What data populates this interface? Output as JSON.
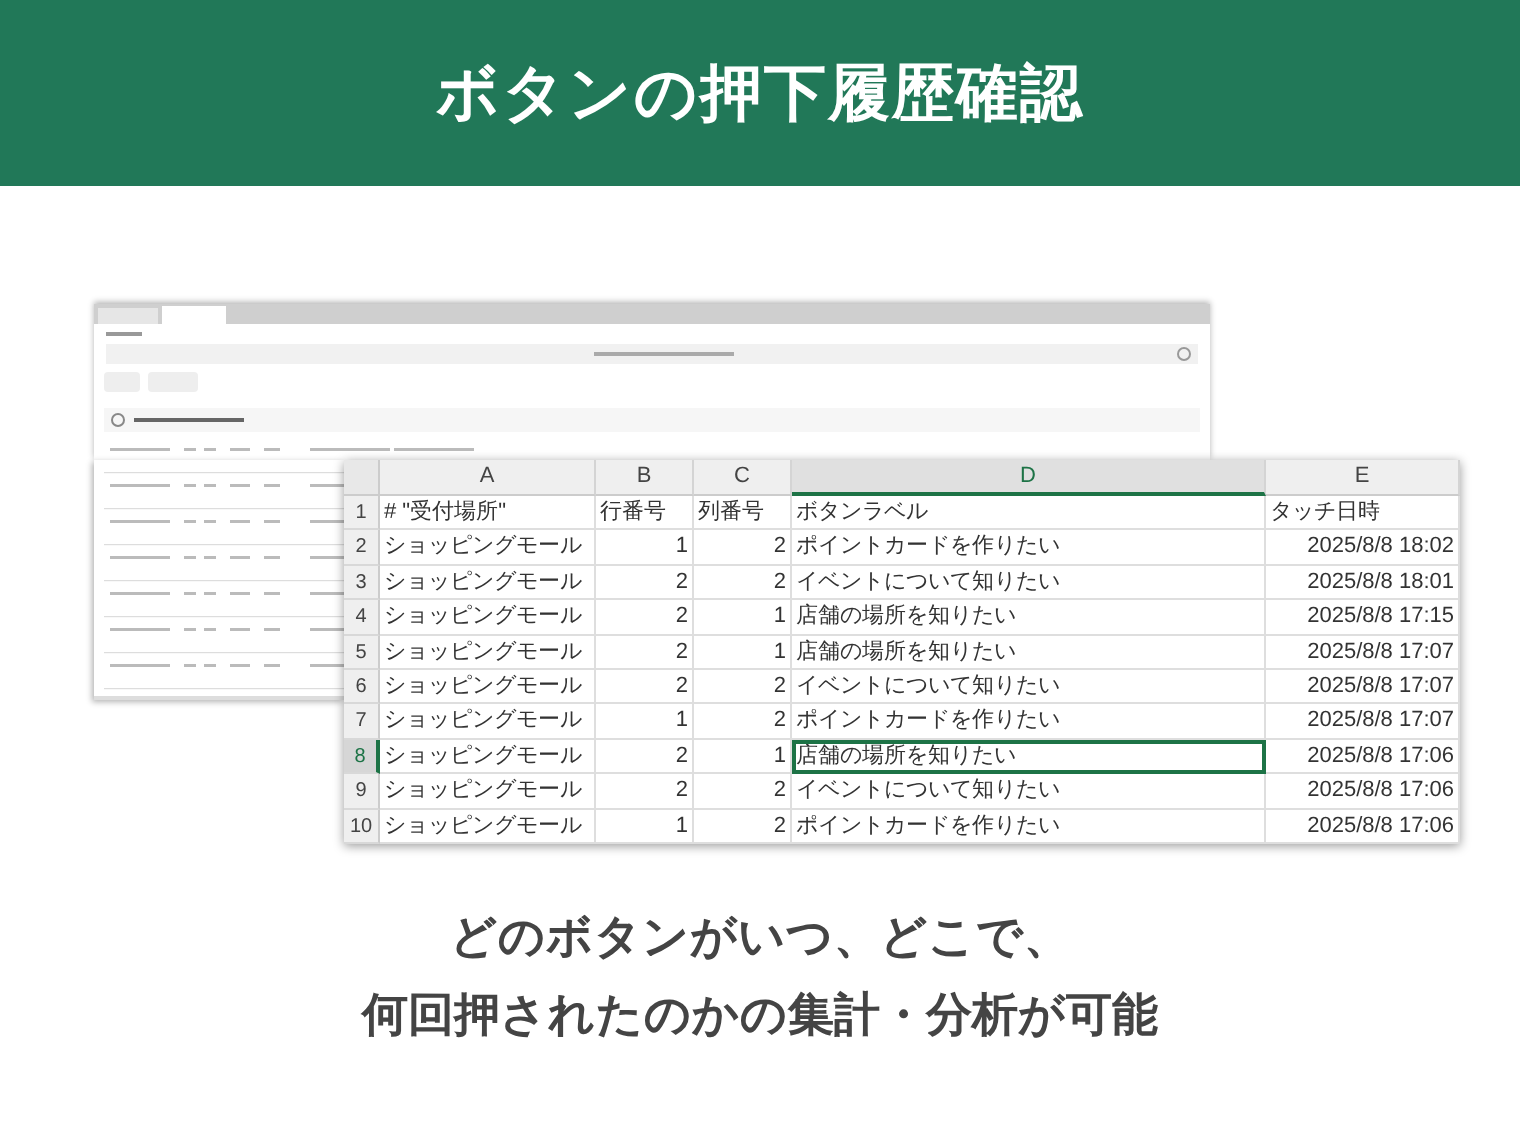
{
  "header": {
    "title": "ボタンの押下履歴確認"
  },
  "spreadsheet": {
    "columns": [
      {
        "label": "A",
        "kind": "text",
        "selected": false
      },
      {
        "label": "B",
        "kind": "number",
        "selected": false
      },
      {
        "label": "C",
        "kind": "number",
        "selected": false
      },
      {
        "label": "D",
        "kind": "text",
        "selected": true
      },
      {
        "label": "E",
        "kind": "number",
        "selected": false
      }
    ],
    "rows": [
      {
        "number": "1",
        "selected": false,
        "cells": [
          "# \"受付場所\"",
          "行番号",
          "列番号",
          "ボタンラベル",
          "タッチ日時"
        ]
      },
      {
        "number": "2",
        "selected": false,
        "cells": [
          "ショッピングモール",
          "1",
          "2",
          "ポイントカードを作りたい",
          "2025/8/8 18:02"
        ]
      },
      {
        "number": "3",
        "selected": false,
        "cells": [
          "ショッピングモール",
          "2",
          "2",
          "イベントについて知りたい",
          "2025/8/8 18:01"
        ]
      },
      {
        "number": "4",
        "selected": false,
        "cells": [
          "ショッピングモール",
          "2",
          "1",
          "店舗の場所を知りたい",
          "2025/8/8 17:15"
        ]
      },
      {
        "number": "5",
        "selected": false,
        "cells": [
          "ショッピングモール",
          "2",
          "1",
          "店舗の場所を知りたい",
          "2025/8/8 17:07"
        ]
      },
      {
        "number": "6",
        "selected": false,
        "cells": [
          "ショッピングモール",
          "2",
          "2",
          "イベントについて知りたい",
          "2025/8/8 17:07"
        ]
      },
      {
        "number": "7",
        "selected": false,
        "cells": [
          "ショッピングモール",
          "1",
          "2",
          "ポイントカードを作りたい",
          "2025/8/8 17:07"
        ]
      },
      {
        "number": "8",
        "selected": true,
        "cells": [
          "ショッピングモール",
          "2",
          "1",
          "店舗の場所を知りたい",
          "2025/8/8 17:06"
        ]
      },
      {
        "number": "9",
        "selected": false,
        "cells": [
          "ショッピングモール",
          "2",
          "2",
          "イベントについて知りたい",
          "2025/8/8 17:06"
        ]
      },
      {
        "number": "10",
        "selected": false,
        "cells": [
          "ショッピングモール",
          "1",
          "2",
          "ポイントカードを作りたい",
          "2025/8/8 17:06"
        ]
      }
    ]
  },
  "caption": [
    "どのボタンがいつ、どこで、",
    "何回押されたのかの集計・分析が可能"
  ]
}
